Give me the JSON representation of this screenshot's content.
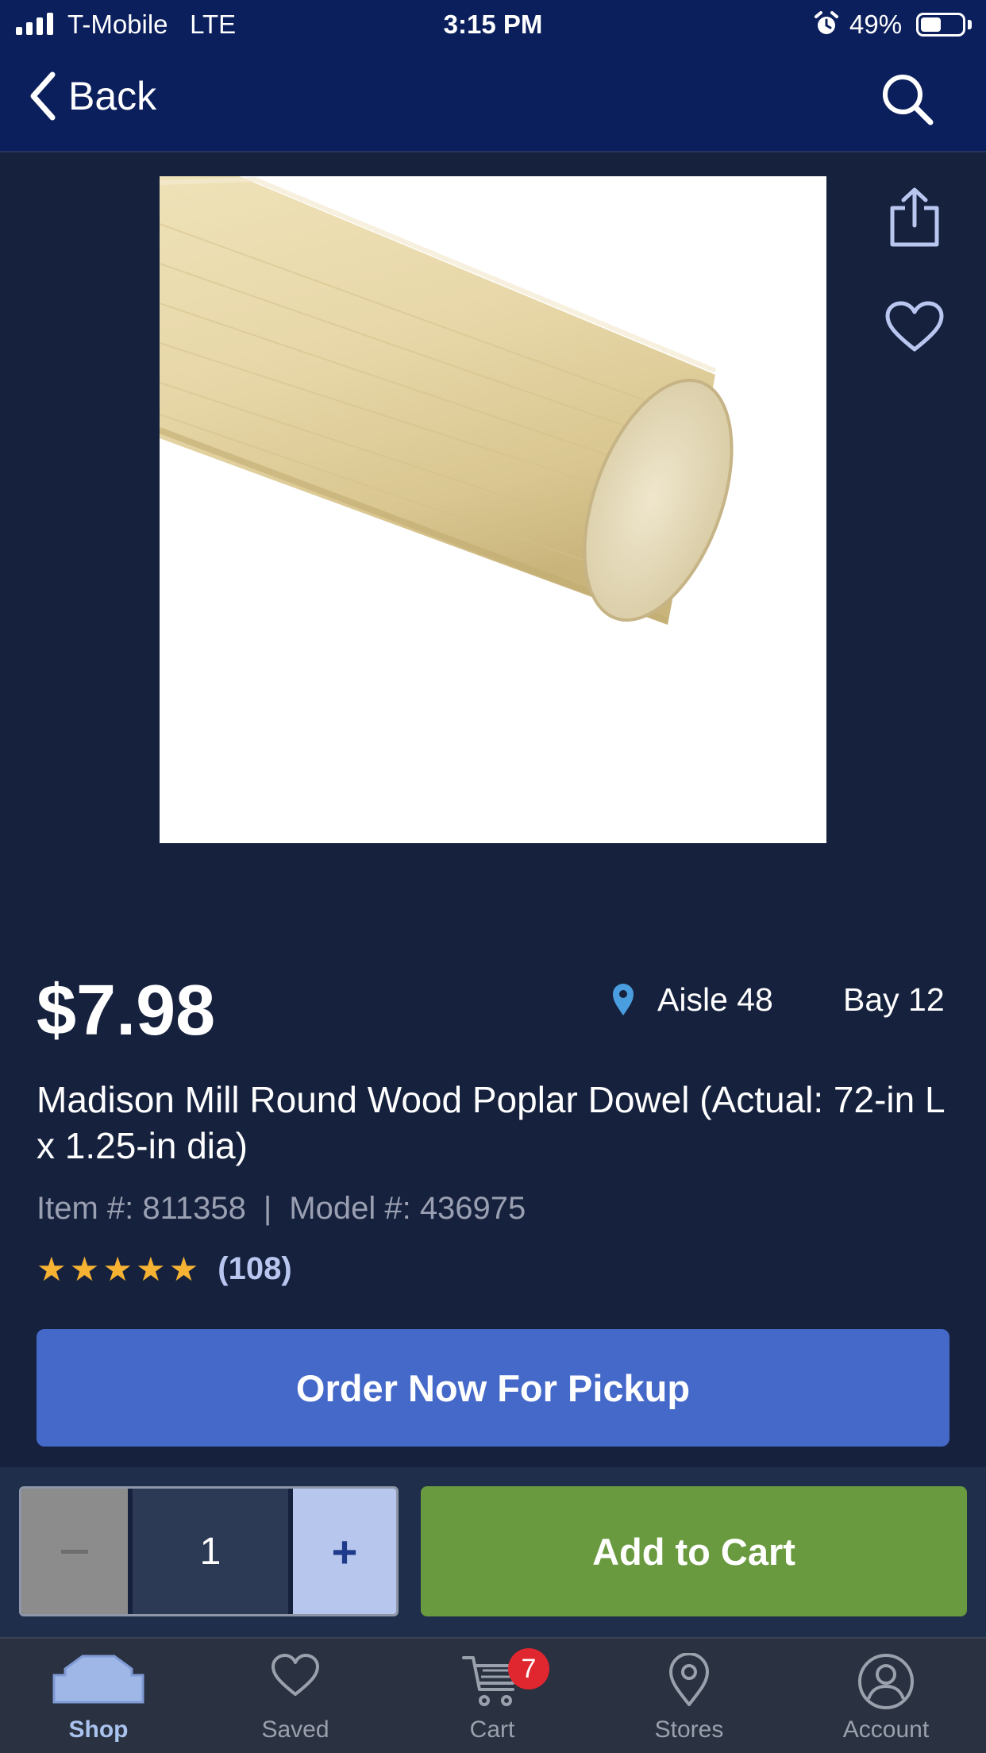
{
  "status_bar": {
    "carrier": "T-Mobile",
    "network": "LTE",
    "time": "3:15 PM",
    "battery": "49%",
    "battery_level": 0.49
  },
  "nav": {
    "back_label": "Back",
    "back_icon": "chevron-left-icon",
    "search_icon": "search-icon"
  },
  "product": {
    "image_icon": "wood-dowel-image",
    "share_icon": "share-icon",
    "favorite_icon": "heart-icon",
    "price": "$7.98",
    "aisle": "Aisle 48",
    "bay": "Bay 12",
    "title": "Madison Mill Round Wood Poplar Dowel (Actual: 72-in L x 1.25-in dia)",
    "item_number": "Item #: 811358",
    "separator": "|",
    "model_number": "Model #: 436975",
    "rating": 5,
    "review_count": "(108)",
    "order_button": "Order Now For Pickup"
  },
  "cart_bar": {
    "minus_label": "–",
    "quantity": "1",
    "plus_label": "+",
    "add_button": "Add to Cart"
  },
  "tabs": [
    {
      "label": "Shop",
      "icon": "house-icon",
      "active": true
    },
    {
      "label": "Saved",
      "icon": "heart-icon",
      "active": false
    },
    {
      "label": "Cart",
      "icon": "cart-icon",
      "active": false,
      "badge": "7"
    },
    {
      "label": "Stores",
      "icon": "location-pin-icon",
      "active": false
    },
    {
      "label": "Account",
      "icon": "person-icon",
      "active": false
    }
  ],
  "colors": {
    "nav_bg": "#0b1f5c",
    "page_bg": "#16213d",
    "order_button": "#4469c9",
    "add_button": "#6a9a3f",
    "star": "#f6b233",
    "badge": "#e0272f"
  }
}
